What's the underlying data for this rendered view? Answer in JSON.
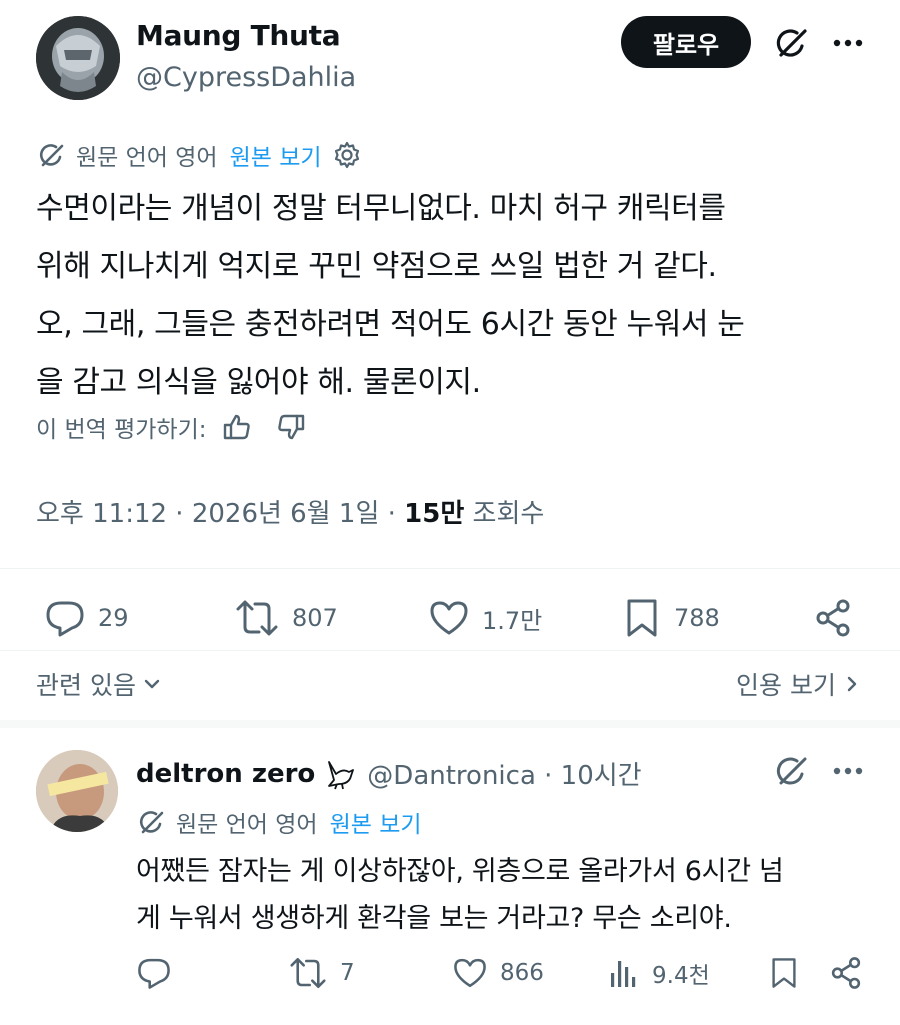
{
  "author": {
    "name": "Maung Thuta",
    "handle": "@CypressDahlia",
    "follow_label": "팔로우"
  },
  "translation": {
    "source_label": "원문 언어 영어",
    "show_original": "원본 보기"
  },
  "tweet": {
    "lines": [
      "수면이라는 개념이 정말 터무니없다. 마치 허구 캐릭터를",
      "위해 지나치게 억지로 꾸민 약점으로 쓰일 법한 거 같다.",
      "오, 그래, 그들은 충전하려면 적어도 6시간 동안 누워서 눈",
      "을 감고 의식을 잃어야 해. 물론이지."
    ],
    "rate_label": "이 번역 평가하기:",
    "timestamp": "오후 11:12 · 2026년 6월 1일 ·",
    "views_count": "15만",
    "views_label": "조회수"
  },
  "actions": {
    "replies": "29",
    "reposts": "807",
    "likes": "1.7만",
    "bookmarks": "788"
  },
  "related_label": "관련 있음",
  "quotes_label": "인용 보기",
  "reply": {
    "name": "deltron zero",
    "handle": "@Dantronica · 10시간",
    "translation": {
      "source_label": "원문 언어 영어",
      "show_original": "원본 보기"
    },
    "lines": [
      "어쨌든 잠자는 게 이상하잖아, 위층으로 올라가서 6시간 넘",
      "게 누워서 생생하게 환각을 보는 거라고? 무슨 소리야."
    ],
    "actions": {
      "replies": "",
      "reposts": "7",
      "likes": "866",
      "views": "9.4천"
    }
  },
  "colors": {
    "text": "#0f1419",
    "secondary": "#536471",
    "link": "#1d9bf0",
    "follow_bg": "#0f1419"
  }
}
